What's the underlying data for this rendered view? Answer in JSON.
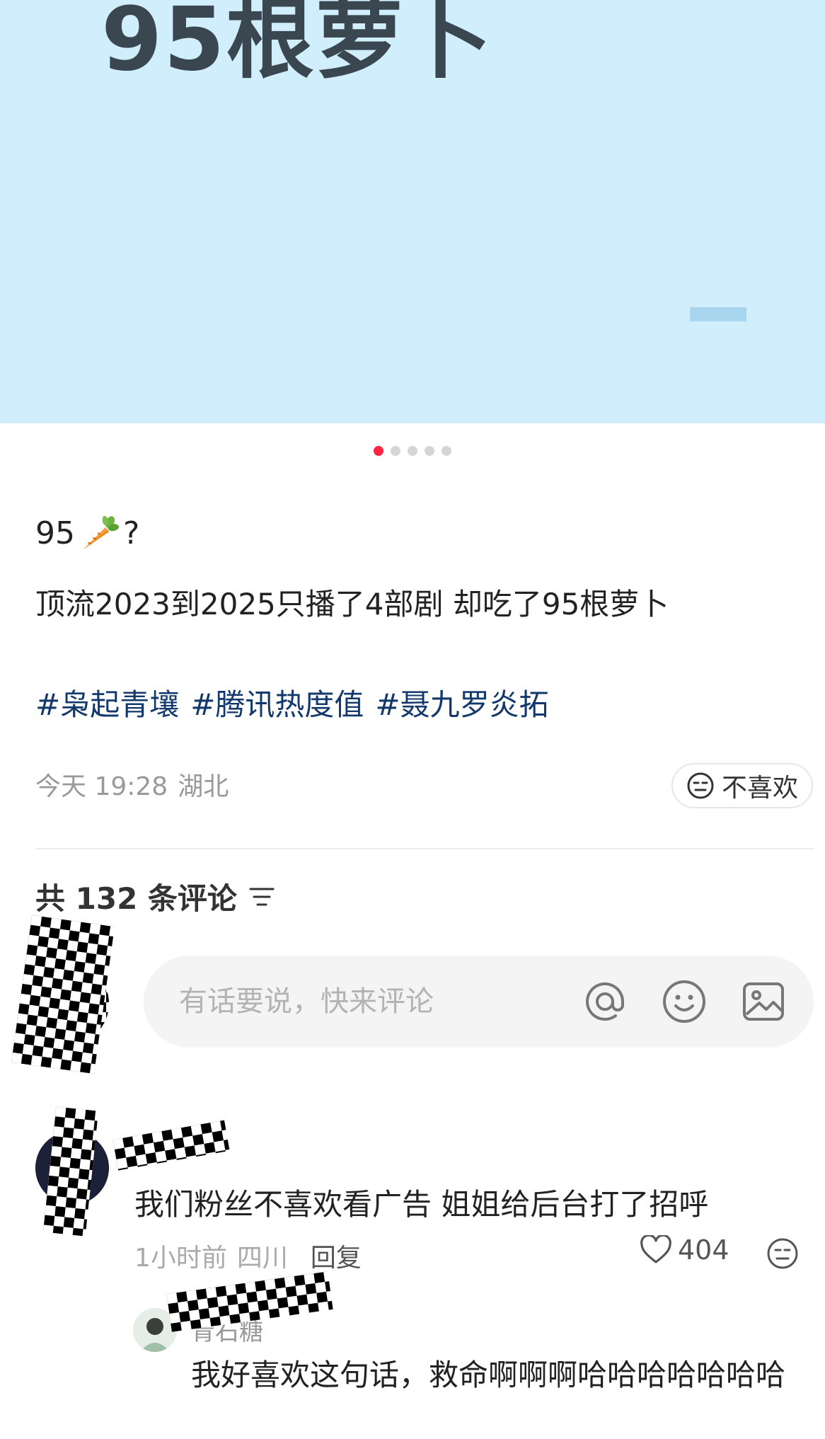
{
  "banner": {
    "title": "95根萝卜",
    "bg_color": "#d1eefc"
  },
  "carousel": {
    "count": 5,
    "active_index": 0
  },
  "post": {
    "title_number": "95",
    "title_emoji": "carrot",
    "title_suffix": "?",
    "body": "顶流2023到2025只播了4部剧 却吃了95根萝卜",
    "tags": [
      "#枭起青壤",
      "#腾讯热度值",
      "#聂九罗炎拓"
    ],
    "time": "今天 19:28",
    "location": "湖北",
    "dislike_label": "不喜欢"
  },
  "comments_section": {
    "header": "共 132 条评论",
    "input_placeholder": "有话要说，快来评论",
    "icons": [
      "at-icon",
      "emoji-icon",
      "image-icon"
    ]
  },
  "comments": [
    {
      "username": "",
      "text": "我们粉丝不喜欢看广告 姐姐给后台打了招呼",
      "time": "1小时前",
      "location": "四川",
      "reply_label": "回复",
      "likes": "404",
      "replies": [
        {
          "username": "青石糖",
          "text": "我好喜欢这句话，救命啊啊啊哈哈哈哈哈哈哈"
        }
      ]
    }
  ],
  "colors": {
    "accent": "#ff2442",
    "tag": "#13386c",
    "muted": "#999999"
  }
}
